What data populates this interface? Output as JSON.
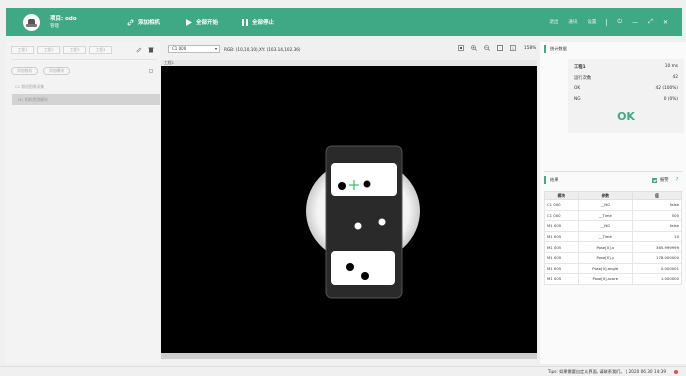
{
  "titlebar": {
    "project_name": "项目: odo",
    "project_sub": "管理",
    "buttons": [
      {
        "label": "添加相机",
        "icon": "link-icon"
      },
      {
        "label": "全部开始",
        "icon": "play-icon"
      },
      {
        "label": "全部停止",
        "icon": "pause-icon"
      }
    ],
    "links": [
      "退出",
      "通讯",
      "设置"
    ],
    "accent": "#3fa884"
  },
  "left": {
    "tabs": [
      "工程1",
      "工程2",
      "工程3",
      "工程4"
    ],
    "pills": [
      "添加相机",
      "添加模块"
    ],
    "tree_items": [
      "C1  相机图像采集",
      "M1  相机检测模块"
    ]
  },
  "center": {
    "camera_select": "C1  000",
    "rgb_readout": "RGB: (10,10,10),XY: (103.14,102.36)",
    "zoom": "158%",
    "image_label": "工程1"
  },
  "right": {
    "stats_title": "统计数据",
    "stats": {
      "project_label": "工程1",
      "project_value": "10  ms",
      "run_label": "运行次数",
      "run_value": "42",
      "ok_label": "OK",
      "ok_value": "42 (100%)",
      "ng_label": "NG",
      "ng_value": "0 (0%)",
      "result": "OK"
    },
    "result_title": "结果",
    "alarm_label": "报警",
    "help": "?",
    "table": {
      "headers": [
        "模块",
        "参数",
        "值"
      ],
      "rows": [
        [
          "C1  000",
          "__NG",
          "false"
        ],
        [
          "C1  000",
          "__Time",
          "500"
        ],
        [
          "M1  005",
          "__NG",
          "false"
        ],
        [
          "M1  005",
          "__Time",
          "10"
        ],
        [
          "M1  005",
          "Pose[0].x",
          "365.999999"
        ],
        [
          "M1  005",
          "Pose[0].y",
          "178.000000"
        ],
        [
          "M1  005",
          "Pose[0].angle",
          "0.000001"
        ],
        [
          "M1  005",
          "Pose[0].score",
          "1.000000"
        ]
      ]
    }
  },
  "status": {
    "tips": "Tips: 如果需要自定义界面, 请联系我们。  |  2020 06 30 14:39"
  }
}
